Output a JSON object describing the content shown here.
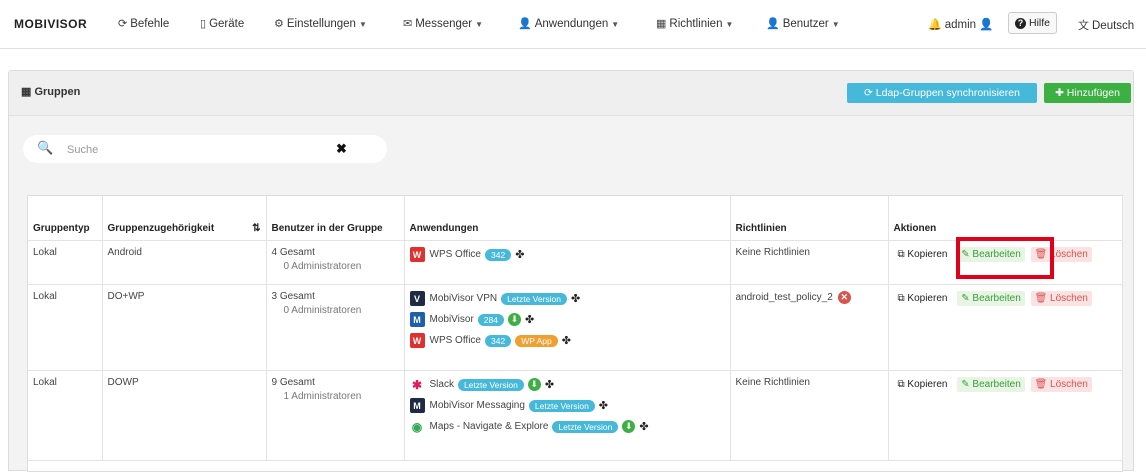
{
  "nav": {
    "logo": "MOBIVISOR",
    "items": [
      {
        "label": "Befehle",
        "icon": "refresh-icon"
      },
      {
        "label": "Geräte",
        "icon": "phone-icon"
      },
      {
        "label": "Einstellungen",
        "icon": "gear-icon"
      },
      {
        "label": "Messenger",
        "icon": "envelope-icon"
      },
      {
        "label": "Anwendungen",
        "icon": "user-icon"
      },
      {
        "label": "Richtlinien",
        "icon": "table-icon"
      },
      {
        "label": "Benutzer",
        "icon": "user-icon"
      }
    ],
    "user": "admin",
    "help": "Hilfe",
    "language": "Deutsch"
  },
  "panel": {
    "title": "Gruppen",
    "ldap_button": "Ldap-Gruppen synchronisieren",
    "add_button": "Hinzufügen"
  },
  "search": {
    "placeholder": "Suche",
    "value": ""
  },
  "table": {
    "headers": [
      "Gruppentyp",
      "Gruppenzugehörigkeit",
      "Benutzer in der Gruppe",
      "Anwendungen",
      "Richtlinien",
      "Aktionen"
    ],
    "rows": [
      {
        "type": "Lokal",
        "membership": "Android",
        "users_total": "4 Gesamt",
        "users_admins": "0 Administratoren",
        "apps": [
          {
            "name": "WPS Office",
            "badges": [
              "342"
            ],
            "extra": []
          }
        ],
        "policy": "Keine Richtlinien"
      },
      {
        "type": "Lokal",
        "membership": "DO+WP",
        "users_total": "3 Gesamt",
        "users_admins": "0 Administratoren",
        "apps": [
          {
            "name": "MobiVisor VPN",
            "badges": [
              "Letzte Version"
            ],
            "extra": []
          },
          {
            "name": "MobiVisor",
            "badges": [
              "284"
            ],
            "extra": []
          },
          {
            "name": "WPS Office",
            "badges": [
              "342"
            ],
            "extra": [
              "WP App"
            ]
          }
        ],
        "policy": "android_test_policy_2"
      },
      {
        "type": "Lokal",
        "membership": "DOWP",
        "users_total": "9 Gesamt",
        "users_admins": "1 Administratoren",
        "apps": [
          {
            "name": "Slack",
            "badges": [
              "Letzte Version"
            ],
            "extra": []
          },
          {
            "name": "MobiVisor Messaging",
            "badges": [
              "Letzte Version"
            ],
            "extra": []
          },
          {
            "name": "Maps - Navigate & Explore",
            "badges": [
              "Letzte Version"
            ],
            "extra": []
          }
        ],
        "policy": "Keine Richtlinien"
      }
    ],
    "actions": {
      "copy": "Kopieren",
      "edit": "Bearbeiten",
      "delete": "Löschen"
    }
  },
  "colors": {
    "accent_info": "#46b8da",
    "accent_success": "#3cb043",
    "danger": "#d9534f",
    "highlight": "#e0001a"
  }
}
